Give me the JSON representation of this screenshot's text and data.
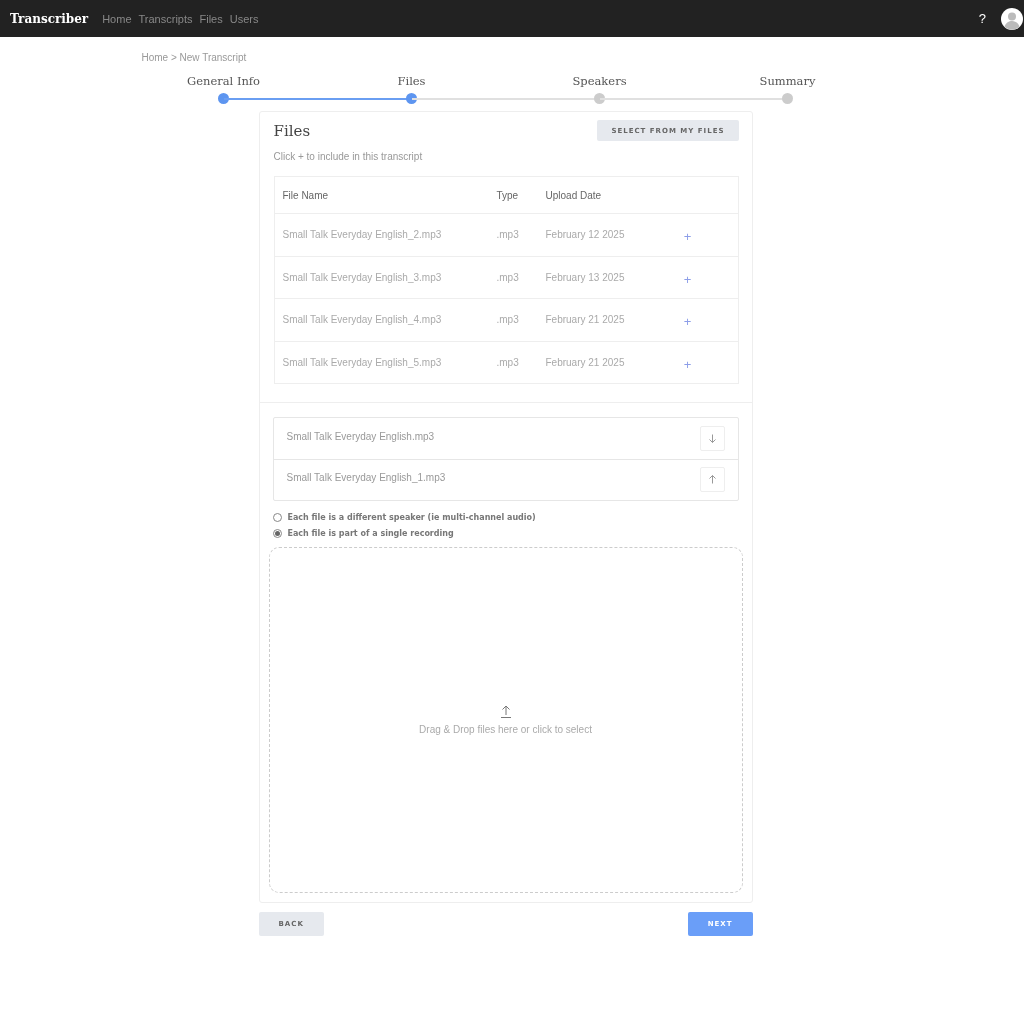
{
  "navbar": {
    "brand": "Transcriber",
    "links": [
      "Home",
      "Transcripts",
      "Files",
      "Users"
    ],
    "help": "?"
  },
  "breadcrumb": "Home > New Transcript",
  "steps": [
    {
      "label": "General Info",
      "done": true
    },
    {
      "label": "Files",
      "done": true
    },
    {
      "label": "Speakers",
      "done": false
    },
    {
      "label": "Summary",
      "done": false
    }
  ],
  "files_panel": {
    "title": "Files",
    "select_button": "SELECT FROM MY FILES",
    "hint": "Click + to include in this transcript",
    "columns": [
      "File Name",
      "Type",
      "Upload Date"
    ],
    "rows": [
      {
        "name": "Small Talk Everyday English_2.mp3",
        "type": ".mp3",
        "date": "February 12 2025",
        "action": "+"
      },
      {
        "name": "Small Talk Everyday English_3.mp3",
        "type": ".mp3",
        "date": "February 13 2025",
        "action": "+"
      },
      {
        "name": "Small Talk Everyday English_4.mp3",
        "type": ".mp3",
        "date": "February 21 2025",
        "action": "+"
      },
      {
        "name": "Small Talk Everyday English_5.mp3",
        "type": ".mp3",
        "date": "February 21 2025",
        "action": "+"
      }
    ],
    "included": [
      {
        "name": "Small Talk Everyday English.mp3",
        "kind": "down"
      },
      {
        "name": "Small Talk Everyday English_1.mp3",
        "kind": "up"
      }
    ],
    "options": [
      {
        "label": "Each file is a different speaker (ie multi-channel audio)",
        "selected": false
      },
      {
        "label": "Each file is part of a single recording",
        "selected": true
      }
    ],
    "dropzone": "Drag & Drop files here or click to select"
  },
  "buttons": {
    "back": "BACK",
    "next": "NEXT"
  }
}
